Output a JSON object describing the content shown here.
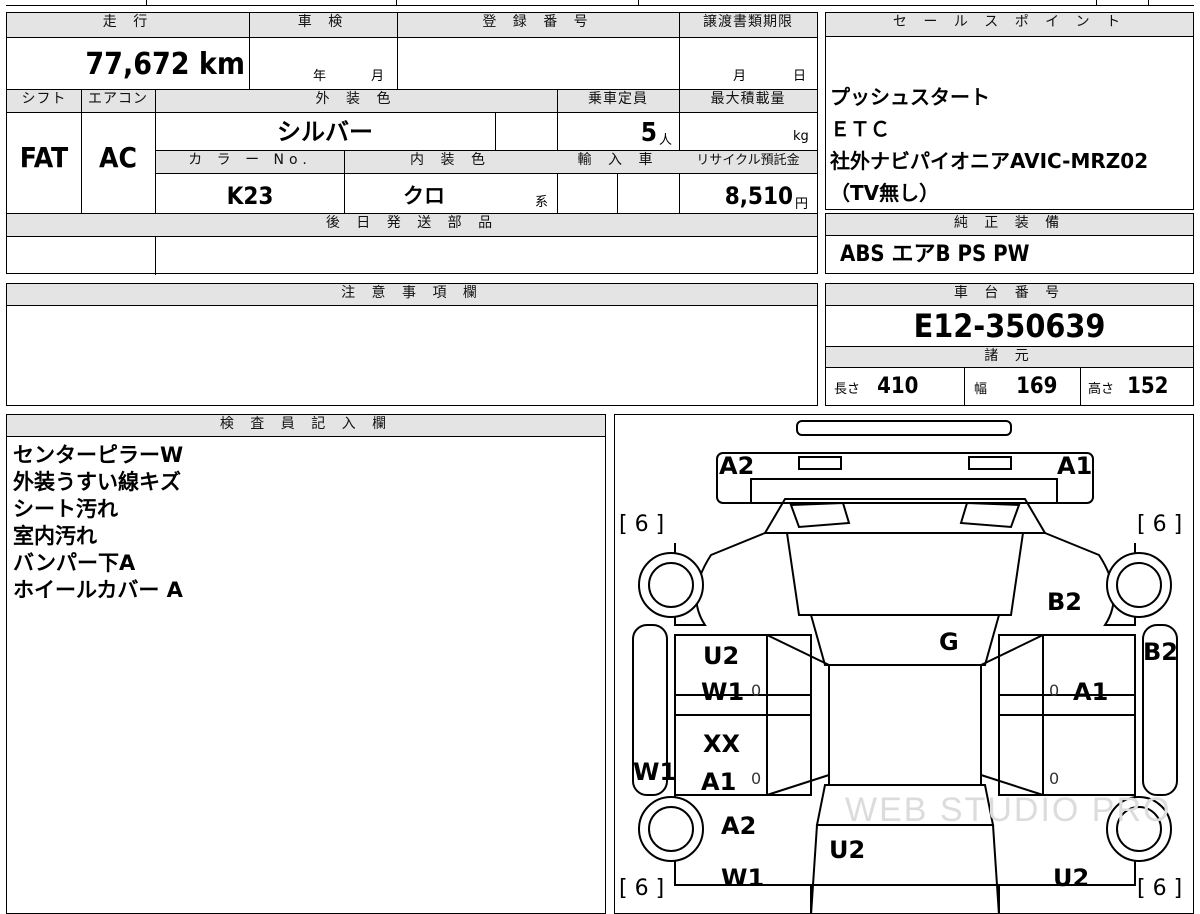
{
  "summary": {
    "mileage_header": "走 行",
    "mileage": "77,672 km",
    "inspection_header": "車 検",
    "inspection_year_unit": "年",
    "inspection_month_unit": "月",
    "registration_header": "登 録 番 号",
    "transfer_header": "譲渡書類期限",
    "transfer_month_unit": "月",
    "transfer_day_unit": "日",
    "shift_header": "シフト",
    "shift": "FAT",
    "ac_header": "エアコン",
    "ac": "AC",
    "exterior_color_header": "外 装 色",
    "exterior_color": "シルバー",
    "capacity_header": "乗車定員",
    "capacity": "5",
    "capacity_unit": "人",
    "max_load_header": "最大積載量",
    "max_load_unit": "kg",
    "color_no_header": "カ ラ ー No.",
    "color_no": "K23",
    "interior_header": "内 装 色",
    "interior": "クロ",
    "interior_suffix": "系",
    "import_header": "輸 入 車",
    "recycle_header": "リサイクル預託金",
    "recycle": "8,510",
    "recycle_unit": "円",
    "later_parts_header": "後 日 発 送 部 品"
  },
  "sales_points": {
    "header": "セ ー ル ス ポ イ ン ト",
    "items": [
      "プッシュスタート",
      "ＥＴＣ",
      "社外ナビパイオニアAVIC-MRZ02",
      "（TV無し）"
    ]
  },
  "standard_equipment": {
    "header": "純 正 装 備",
    "value": "ABS エアB PS PW"
  },
  "caution": {
    "header": "注 意 事 項 欄"
  },
  "chassis": {
    "header": "車 台 番 号",
    "number": "E12-350639"
  },
  "specs": {
    "header": "諸 元",
    "length_label": "長さ",
    "length": "410",
    "width_label": "幅",
    "width": "169",
    "height_label": "高さ",
    "height": "152"
  },
  "inspector": {
    "header": "検 査 員 記 入 欄",
    "notes": [
      "センターピラーW",
      "外装うすい線キズ",
      "シート汚れ",
      "室内汚れ",
      "バンパー下A",
      "ホイールカバー A"
    ]
  },
  "diagram": {
    "marks": {
      "front_left_corner": "A2",
      "front_right_corner": "A1",
      "left_front_fender": "[ 6 ]",
      "right_front_fender": "[ 6 ]",
      "right_front_panel": "B2",
      "roof": "G",
      "left_front_door_a": "U2",
      "left_front_door_b": "W1",
      "right_front_door": "A1",
      "right_side_sill": "B2",
      "left_rear_door_a": "XX",
      "left_rear_door_b": "A1",
      "left_side_sill": "W1",
      "left_rear_fender": "A2",
      "rear_center": "U2",
      "left_rear_bottom": "W1",
      "right_rear_bottom": "U2",
      "left_rear_bracket": "[ 6 ]",
      "right_rear_bracket": "[ 6 ]"
    },
    "zero_marks": [
      "0",
      "0",
      "0",
      "0"
    ],
    "watermark": "WEB STUDIO PRO"
  }
}
